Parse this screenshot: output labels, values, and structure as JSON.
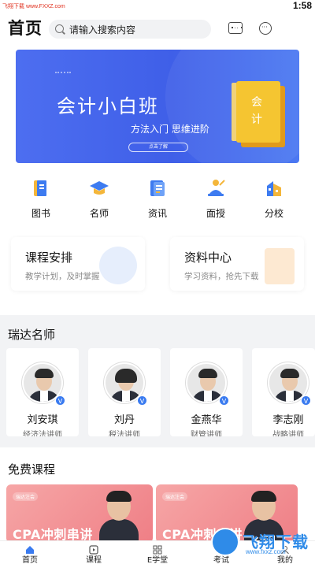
{
  "status_bar": {
    "watermark": "飞翔下载 www.FXXZ.com",
    "time": "1:58"
  },
  "header": {
    "title": "首页",
    "search_placeholder": "请输入搜索内容"
  },
  "banner": {
    "title": "会计小白班",
    "subtitle": "方法入门 思维进阶",
    "button": "点击了解",
    "book_text": "会计",
    "active_dot": 0,
    "dot_count": 3
  },
  "quick_nav": [
    {
      "label": "图书",
      "icon": "book-icon"
    },
    {
      "label": "名师",
      "icon": "graduation-cap-icon"
    },
    {
      "label": "资讯",
      "icon": "document-icon"
    },
    {
      "label": "面授",
      "icon": "lecture-icon"
    },
    {
      "label": "分校",
      "icon": "building-icon"
    }
  ],
  "feature_cards": [
    {
      "title": "课程安排",
      "subtitle": "教学计划，及时掌握"
    },
    {
      "title": "资料中心",
      "subtitle": "学习资料，抢先下载"
    }
  ],
  "teachers_section": {
    "title": "瑞达名师"
  },
  "teachers": [
    {
      "name": "刘安琪",
      "role": "经济法讲师"
    },
    {
      "name": "刘丹",
      "role": "税法讲师"
    },
    {
      "name": "金燕华",
      "role": "财管讲师"
    },
    {
      "name": "李志刚",
      "role": "战略讲师"
    }
  ],
  "courses_section": {
    "title": "免费课程"
  },
  "courses": [
    {
      "tag": "瑞达注会",
      "name": "CPA冲刺串讲"
    },
    {
      "tag": "瑞达注会",
      "name": "CPA冲刺串讲"
    }
  ],
  "tabbar": [
    {
      "label": "首页",
      "icon": "home-icon",
      "active": true
    },
    {
      "label": "课程",
      "icon": "play-icon",
      "active": false
    },
    {
      "label": "E学堂",
      "icon": "grid-icon",
      "active": false
    },
    {
      "label": "考试",
      "icon": "exam-icon",
      "active": false
    },
    {
      "label": "我的",
      "icon": "user-icon",
      "active": false
    }
  ],
  "watermark": {
    "text": "飞翔下载",
    "url": "www.fxxz.com"
  },
  "colors": {
    "brand_blue": "#4d6ef0",
    "book_yellow": "#f5c531",
    "course_pink": "#ef7f86",
    "active_tab": "#3a7bf0"
  }
}
